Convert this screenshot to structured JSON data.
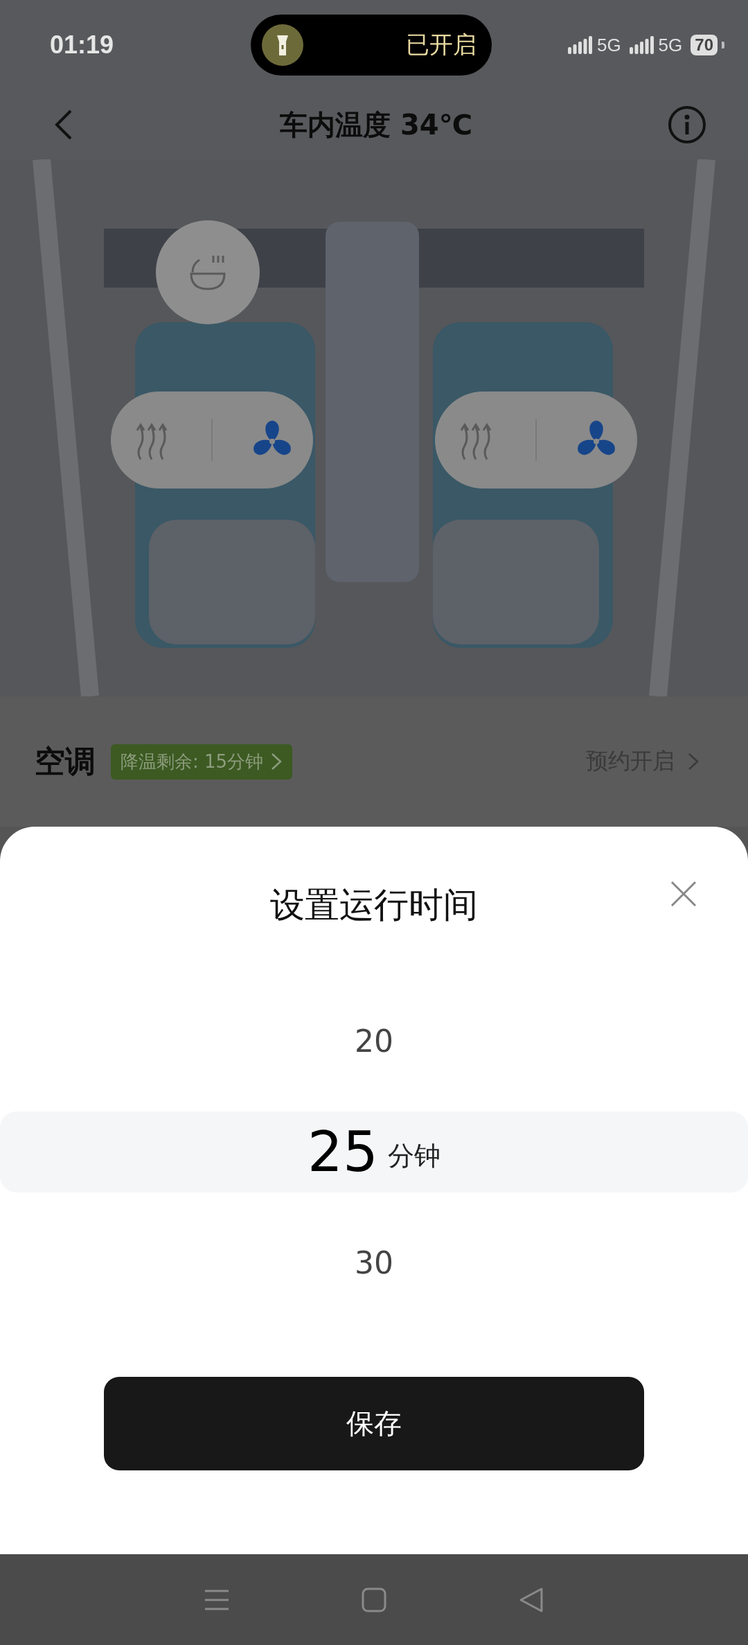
{
  "status_bar": {
    "time": "01:19",
    "pill_text": "已开启",
    "networks": [
      "5G",
      "5G"
    ],
    "battery": "70"
  },
  "header": {
    "title": "车内温度 34℃"
  },
  "car_view": {
    "seats": [
      {
        "ventilation": true
      },
      {
        "ventilation": true
      }
    ]
  },
  "ac": {
    "label": "空调",
    "badge": "降温剩余: 15分钟",
    "schedule": "预约开启"
  },
  "sheet": {
    "title": "设置运行时间",
    "unit": "分钟",
    "options": [
      {
        "value": "20",
        "selected": false
      },
      {
        "value": "25",
        "selected": true
      },
      {
        "value": "30",
        "selected": false
      }
    ],
    "save": "保存"
  }
}
